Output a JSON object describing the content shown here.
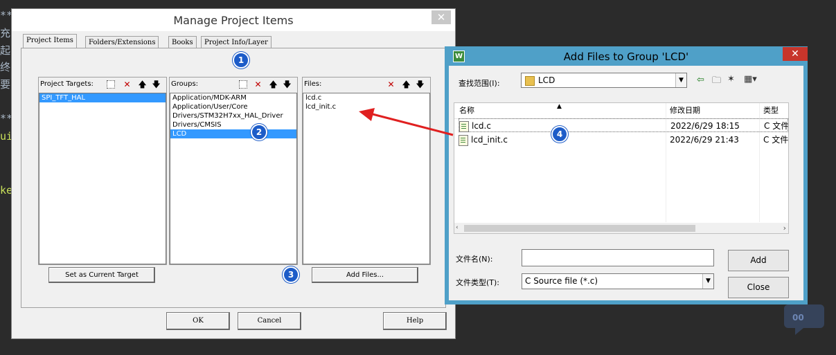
{
  "background": {
    "lines": [
      {
        "text": "**",
        "color": "#a9b7c6"
      },
      {
        "text": "充",
        "color": "#a9b7c6"
      },
      {
        "text": "起",
        "color": "#a9b7c6"
      },
      {
        "text": "终",
        "color": "#a9b7c6"
      },
      {
        "text": "要",
        "color": "#a9b7c6"
      },
      {
        "text": "**",
        "color": "#a9b7c6"
      },
      {
        "text": "ui",
        "color": "#c9e05a"
      },
      {
        "text": "ke",
        "color": "#c9e05a"
      }
    ]
  },
  "manage": {
    "title": "Manage Project Items",
    "close_glyph": "✕",
    "tabs": [
      "Project Items",
      "Folders/Extensions",
      "Books",
      "Project Info/Layer"
    ],
    "targets": {
      "label": "Project Targets:",
      "items": [
        "SPI_TFT_HAL"
      ],
      "selected": 0
    },
    "groups": {
      "label": "Groups:",
      "items": [
        "Application/MDK-ARM",
        "Application/User/Core",
        "Drivers/STM32H7xx_HAL_Driver",
        "Drivers/CMSIS",
        "LCD"
      ],
      "selected": 4
    },
    "files": {
      "label": "Files:",
      "items": [
        "lcd.c",
        "lcd_init.c"
      ]
    },
    "set_target": "Set as Current Target",
    "add_files": "Add Files...",
    "ok": "OK",
    "cancel": "Cancel",
    "help": "Help",
    "badges": [
      "1",
      "2",
      "3",
      "4"
    ]
  },
  "addfiles": {
    "title": "Add Files to Group 'LCD'",
    "app_icon_letter": "W",
    "close_glyph": "✕",
    "lookin_label": "查找范围(I):",
    "lookin_value": "LCD",
    "columns": {
      "name": "名称",
      "date": "修改日期",
      "type": "类型"
    },
    "files": [
      {
        "name": "lcd.c",
        "date": "2022/6/29 18:15",
        "type": "C 文件"
      },
      {
        "name": "lcd_init.c",
        "date": "2022/6/29 21:43",
        "type": "C 文件"
      }
    ],
    "filename_label": "文件名(N):",
    "filename_value": "",
    "filetype_label": "文件类型(T):",
    "filetype_value": "C Source file (*.c)",
    "add": "Add",
    "close": "Close"
  },
  "colors": {
    "selection": "#3399ff",
    "badge": "#1d5cc8",
    "arrow": "#e02020",
    "dialog_border": "#4fa0c8"
  }
}
